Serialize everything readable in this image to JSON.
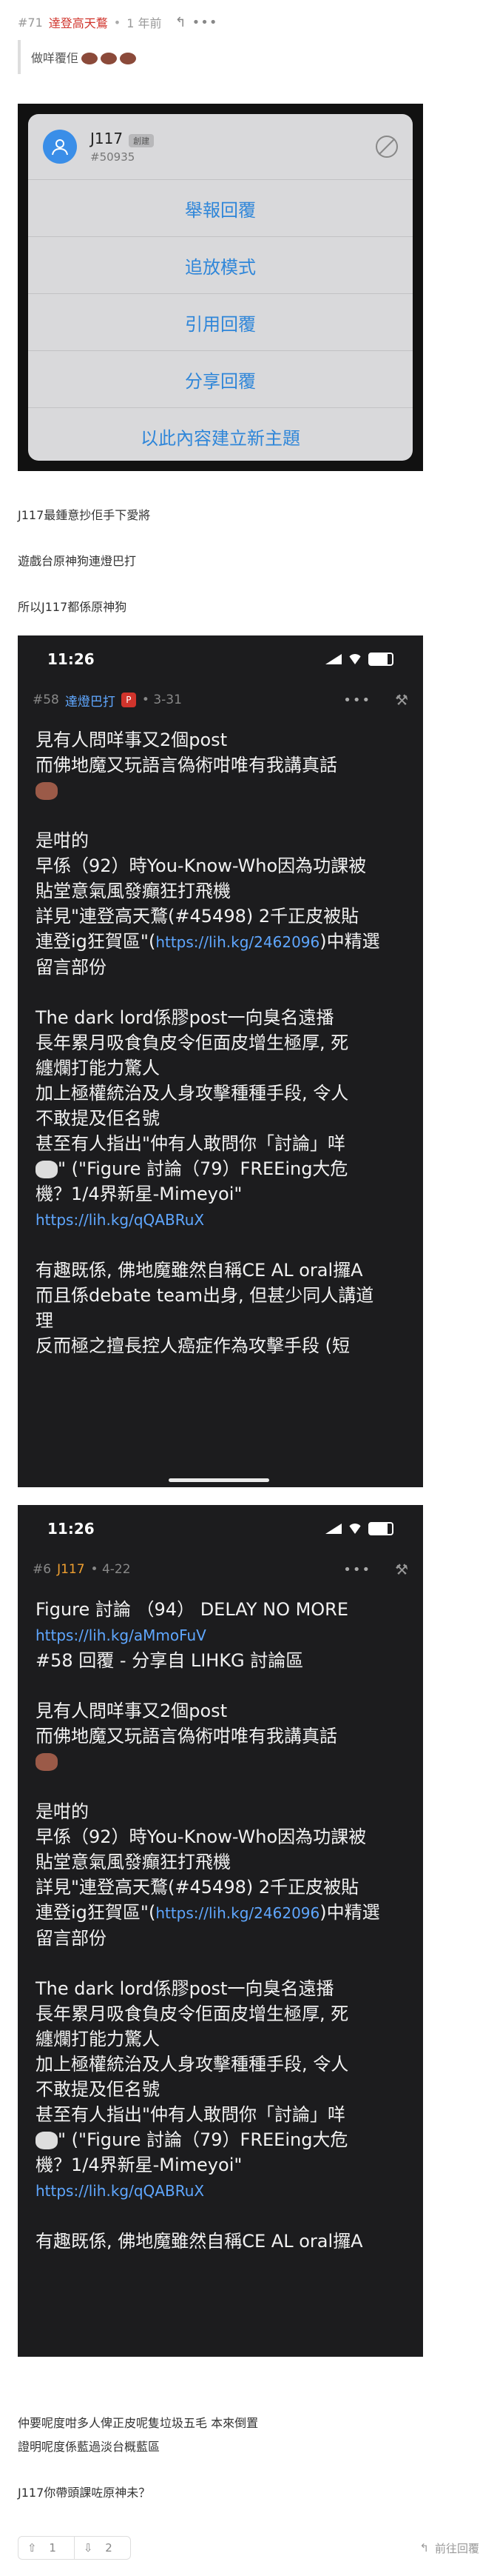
{
  "header": {
    "post_num": "#71",
    "author": "達登高天鶩",
    "separator": "•",
    "time": "1 年前",
    "reply_icon": "reply-icon",
    "more_icon": "more-icon"
  },
  "quote": {
    "text": "做咩覆佢"
  },
  "screenshot1": {
    "username": "J117",
    "badge": "創建",
    "user_id": "#50935",
    "menu": [
      "舉報回覆",
      "追放模式",
      "引用回覆",
      "分享回覆",
      "以此內容建立新主題"
    ]
  },
  "paragraphs1": [
    "J117最鍾意抄佢手下愛將",
    "遊戲台原神狗連燈巴打",
    "所以J117都係原神狗"
  ],
  "screenshot2": {
    "time": "11:26",
    "post_num": "#58",
    "author": "達燈巴打",
    "author_badge": "P",
    "date": "3-31",
    "more": "•••",
    "lines": [
      "見有人問咩事又2個post",
      "而佛地魔又玩語言偽術咁唯有我講真話"
    ],
    "lines_b": [
      "是咁的",
      "早係（92）時You-Know-Who因為功課被",
      "貼堂意氣風發癲狂打飛機"
    ],
    "ref_line_pre": "詳見\"連登高天鶩(#45498) 2千正皮被貼",
    "ref_line2_pre": "連登ig狂賀區\"(",
    "ref_link": "https://lih.kg/2462096",
    "ref_line2_post": ")中精選",
    "ref_line3": "留言部份",
    "lines_c": [
      "The dark lord係膠post一向臭名遠播",
      "長年累月吸食負皮令佢面皮增生極厚, 死",
      "纏爛打能力驚人",
      "加上極權統治及人身攻擊種種手段, 令人",
      "不敢提及佢名號",
      "甚至有人指出\"仲有人敢問你「討論」咩"
    ],
    "fig_line": "\" (\"Figure 討論（79）FREEing大危",
    "fig_line2": "機？1/4界新星-Mimeyoi\"",
    "fig_link": "https://lih.kg/qQABRuX",
    "lines_d": [
      "有趣既係, 佛地魔雖然自稱CE AL oral攞A",
      "而且係debate team出身, 但甚少同人講道",
      "理",
      "反而極之擅長控人癌症作為攻擊手段 (短"
    ]
  },
  "screenshot3": {
    "time": "11:26",
    "post_num": "#6",
    "author": "J117",
    "date": "4-22",
    "title_line": "Figure 討論 （94） DELAY NO MORE",
    "title_link": "https://lih.kg/aMmoFuV",
    "reply_line": "#58 回覆 - 分享自 LIHKG 討論區",
    "lines": [
      "見有人問咩事又2個post",
      "而佛地魔又玩語言偽術咁唯有我講真話"
    ],
    "lines_b": [
      "是咁的",
      "早係（92）時You-Know-Who因為功課被",
      "貼堂意氣風發癲狂打飛機"
    ],
    "ref_line_pre": "詳見\"連登高天鶩(#45498) 2千正皮被貼",
    "ref_line2_pre": "連登ig狂賀區\"(",
    "ref_link": "https://lih.kg/2462096",
    "ref_line2_post": ")中精選",
    "ref_line3": "留言部份",
    "lines_c": [
      "The dark lord係膠post一向臭名遠播",
      "長年累月吸食負皮令佢面皮增生極厚, 死",
      "纏爛打能力驚人",
      "加上極權統治及人身攻擊種種手段, 令人",
      "不敢提及佢名號",
      "甚至有人指出\"仲有人敢問你「討論」咩"
    ],
    "fig_line": "\" (\"Figure 討論（79）FREEing大危",
    "fig_line2": "機？1/4界新星-Mimeyoi\"",
    "fig_link": "https://lih.kg/qQABRuX",
    "cut_line": "有趣既係, 佛地魔雖然自稱CE AL oral攞A"
  },
  "paragraphs2": [
    "仲要呢度咁多人俾正皮呢隻垃圾五毛 本來倒置",
    "證明呢度係藍過淡台概藍區"
  ],
  "question": "J117你帶頭課咗原神未？",
  "footer": {
    "upvotes": "1",
    "downvotes": "2",
    "reply_label": "前往回覆"
  }
}
